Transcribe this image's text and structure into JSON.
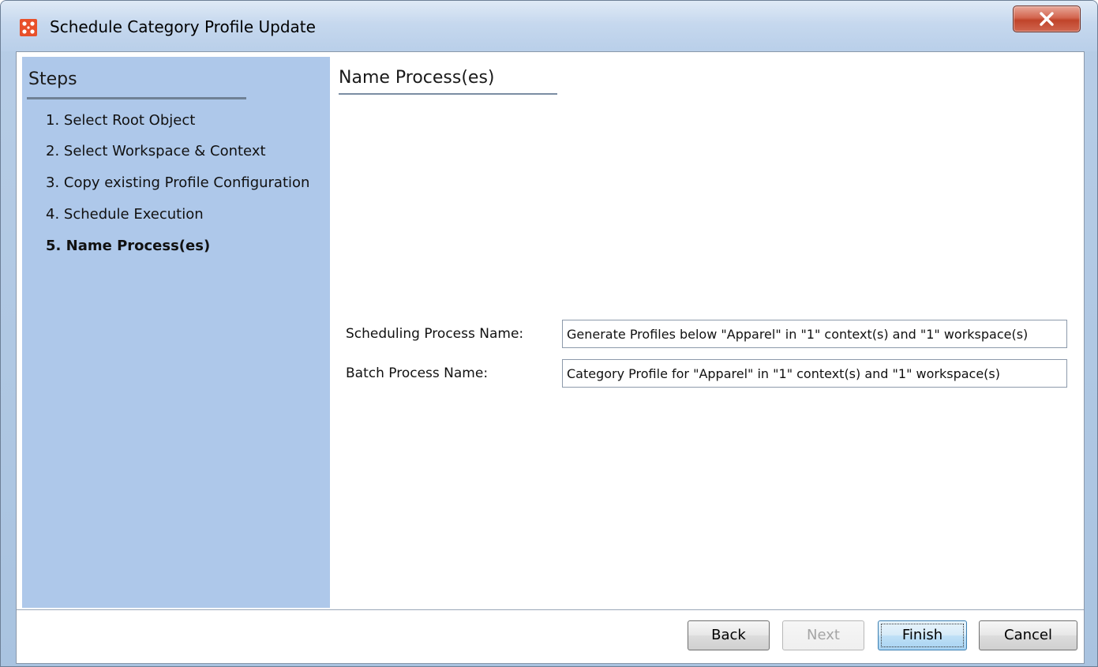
{
  "window": {
    "title": "Schedule Category Profile Update"
  },
  "steps": {
    "title": "Steps",
    "items": [
      {
        "label": "1. Select Root Object"
      },
      {
        "label": "2. Select Workspace & Context"
      },
      {
        "label": "3. Copy existing Profile Configuration"
      },
      {
        "label": "4. Schedule Execution"
      },
      {
        "label": "5. Name Process(es)"
      }
    ]
  },
  "content": {
    "title": "Name Process(es)",
    "scheduling_label": "Scheduling Process Name:",
    "scheduling_value": "Generate Profiles below \"Apparel\" in \"1\" context(s) and \"1\" workspace(s)",
    "batch_label": "Batch Process Name:",
    "batch_value": "Category Profile for \"Apparel\" in \"1\" context(s) and \"1\" workspace(s)"
  },
  "buttons": {
    "back": "Back",
    "next": "Next",
    "finish": "Finish",
    "cancel": "Cancel"
  },
  "colors": {
    "steps_panel": "#aec8ea",
    "app_icon": "#e8502a",
    "close_button": "#c7452c"
  },
  "icons": {
    "app": "app-logo-icon",
    "close": "close-icon"
  }
}
